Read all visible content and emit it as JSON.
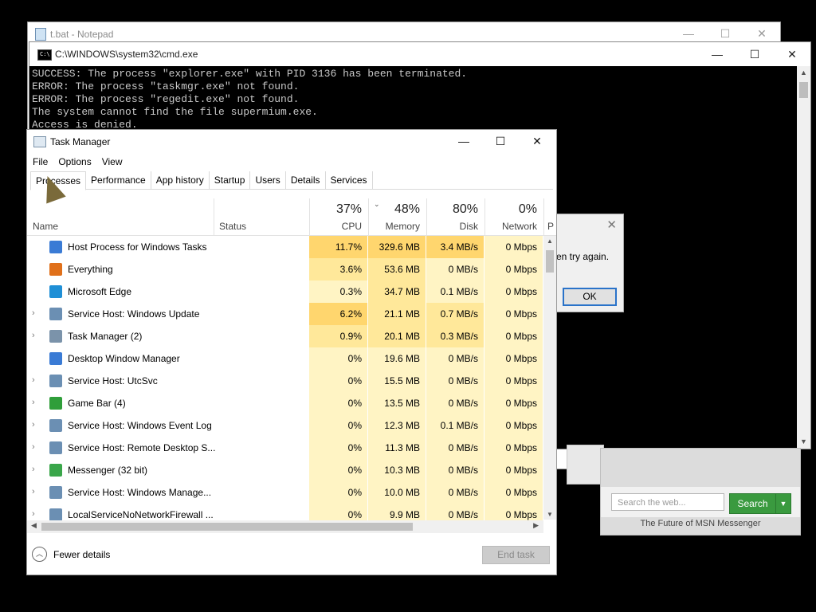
{
  "notepad": {
    "title": "t.bat - Notepad",
    "min": "—",
    "max": "☐",
    "close": "✕"
  },
  "cmd": {
    "title": "C:\\WINDOWS\\system32\\cmd.exe",
    "icon_text": "C:\\",
    "min": "—",
    "max": "☐",
    "close": "✕",
    "lines": [
      "SUCCESS: The process \"explorer.exe\" with PID 3136 has been terminated.",
      "ERROR: The process \"taskmgr.exe\" not found.",
      "ERROR: The process \"regedit.exe\" not found.",
      "The system cannot find the file supermium.exe.",
      "Access is denied."
    ]
  },
  "dialog": {
    "message": "en try again.",
    "ok": "OK",
    "close": "✕"
  },
  "msn": {
    "search_placeholder": "Search the web...",
    "search_button": "Search",
    "footer": "The Future of MSN Messenger"
  },
  "taskmanager": {
    "title": "Task Manager",
    "min": "—",
    "max": "☐",
    "close": "✕",
    "menu": [
      "File",
      "Options",
      "View"
    ],
    "tabs": [
      "Processes",
      "Performance",
      "App history",
      "Startup",
      "Users",
      "Details",
      "Services"
    ],
    "columns": {
      "name": "Name",
      "status": "Status",
      "cpu_pct": "37%",
      "cpu": "CPU",
      "mem_pct": "48%",
      "mem": "Memory",
      "disk_pct": "80%",
      "disk": "Disk",
      "net_pct": "0%",
      "net": "Network",
      "extra": "P"
    },
    "processes": [
      {
        "name": "Host Process for Windows Tasks",
        "cpu": "11.7%",
        "mem": "329.6 MB",
        "disk": "3.4 MB/s",
        "net": "0 Mbps",
        "exp": false,
        "icon": "window-icon",
        "color": "#3a7bd5"
      },
      {
        "name": "Everything",
        "cpu": "3.6%",
        "mem": "53.6 MB",
        "disk": "0 MB/s",
        "net": "0 Mbps",
        "exp": false,
        "icon": "magnifier-icon",
        "color": "#e0701a"
      },
      {
        "name": "Microsoft Edge",
        "cpu": "0.3%",
        "mem": "34.7 MB",
        "disk": "0.1 MB/s",
        "net": "0 Mbps",
        "exp": false,
        "icon": "edge-icon",
        "color": "#1f8fd6"
      },
      {
        "name": "Service Host: Windows Update",
        "cpu": "6.2%",
        "mem": "21.1 MB",
        "disk": "0.7 MB/s",
        "net": "0 Mbps",
        "exp": true,
        "icon": "gear-icon",
        "color": "#6b8fb3"
      },
      {
        "name": "Task Manager (2)",
        "cpu": "0.9%",
        "mem": "20.1 MB",
        "disk": "0.3 MB/s",
        "net": "0 Mbps",
        "exp": true,
        "icon": "taskmanager-icon",
        "color": "#7b93aa"
      },
      {
        "name": "Desktop Window Manager",
        "cpu": "0%",
        "mem": "19.6 MB",
        "disk": "0 MB/s",
        "net": "0 Mbps",
        "exp": false,
        "icon": "window-icon",
        "color": "#3a7bd5"
      },
      {
        "name": "Service Host: UtcSvc",
        "cpu": "0%",
        "mem": "15.5 MB",
        "disk": "0 MB/s",
        "net": "0 Mbps",
        "exp": true,
        "icon": "gear-icon",
        "color": "#6b8fb3"
      },
      {
        "name": "Game Bar (4)",
        "cpu": "0%",
        "mem": "13.5 MB",
        "disk": "0 MB/s",
        "net": "0 Mbps",
        "exp": true,
        "icon": "gamebar-icon",
        "color": "#2f9e3a"
      },
      {
        "name": "Service Host: Windows Event Log",
        "cpu": "0%",
        "mem": "12.3 MB",
        "disk": "0.1 MB/s",
        "net": "0 Mbps",
        "exp": true,
        "icon": "gear-icon",
        "color": "#6b8fb3"
      },
      {
        "name": "Service Host: Remote Desktop S...",
        "cpu": "0%",
        "mem": "11.3 MB",
        "disk": "0 MB/s",
        "net": "0 Mbps",
        "exp": true,
        "icon": "gear-icon",
        "color": "#6b8fb3"
      },
      {
        "name": "Messenger (32 bit)",
        "cpu": "0%",
        "mem": "10.3 MB",
        "disk": "0 MB/s",
        "net": "0 Mbps",
        "exp": true,
        "icon": "messenger-icon",
        "color": "#3aa64a"
      },
      {
        "name": "Service Host: Windows Manage...",
        "cpu": "0%",
        "mem": "10.0 MB",
        "disk": "0 MB/s",
        "net": "0 Mbps",
        "exp": true,
        "icon": "gear-icon",
        "color": "#6b8fb3"
      },
      {
        "name": "LocalServiceNoNetworkFirewall ...",
        "cpu": "0%",
        "mem": "9.9 MB",
        "disk": "0 MB/s",
        "net": "0 Mbps",
        "exp": true,
        "icon": "gear-icon",
        "color": "#6b8fb3"
      }
    ],
    "fewer_details": "Fewer details",
    "end_task": "End task"
  }
}
